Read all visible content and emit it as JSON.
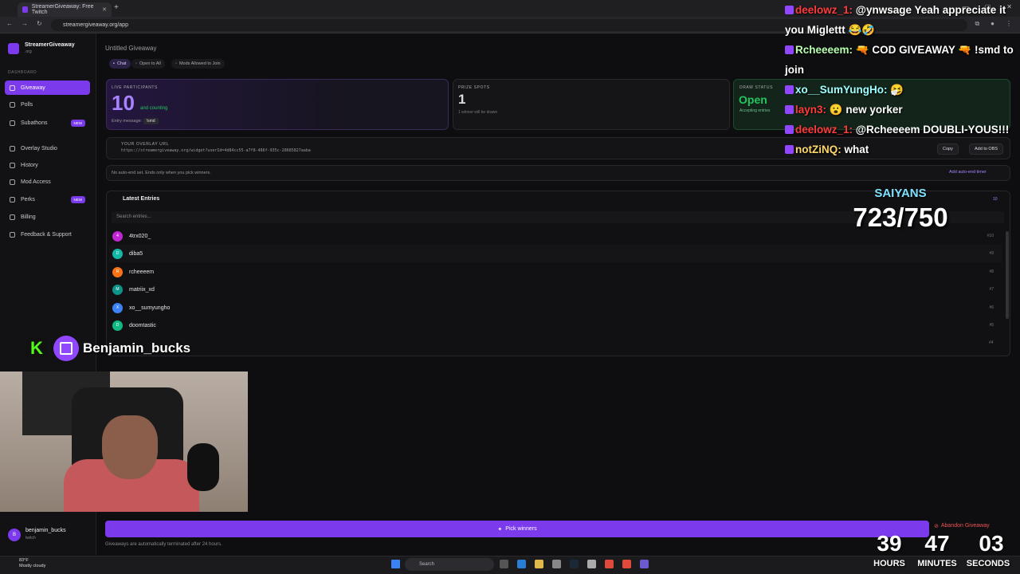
{
  "browser": {
    "tab_title": "StreamerGiveaway: Free Twitch",
    "url": "streamergiveaway.org/app"
  },
  "sidebar": {
    "brand": "StreamerGiveaway",
    "brand_sub": ".org",
    "section": "DASHBOARD",
    "items": [
      {
        "label": "Giveaway",
        "active": true
      },
      {
        "label": "Polls"
      },
      {
        "label": "Subathons",
        "badge": "NEW"
      },
      {
        "label": "Overlay Studio"
      },
      {
        "label": "History"
      },
      {
        "label": "Mod Access"
      },
      {
        "label": "Perks",
        "badge": "NEW"
      },
      {
        "label": "Billing"
      },
      {
        "label": "Feedback & Support"
      }
    ],
    "user": {
      "name": "benjamin_bucks",
      "platform": "twitch",
      "initial": "B"
    }
  },
  "main": {
    "title": "Untitled Giveaway",
    "chips": [
      "Chat",
      "Open to All",
      "Mods Allowed to Join"
    ],
    "participants": {
      "label": "LIVE PARTICIPANTS",
      "count": "10",
      "counting": "and counting",
      "entry_label": "Entry message:",
      "entry_cmd": "!smd"
    },
    "prize": {
      "label": "PRIZE SPOTS",
      "count": "1",
      "sub": "1 winner will be drawn"
    },
    "draw": {
      "label": "DRAW STATUS",
      "status": "Open",
      "sub": "Accepting entries"
    },
    "overlay": {
      "label": "YOUR OVERLAY URL",
      "url": "https://streamergiveaway.org/widget?userId=4d84cc55-a7f8-486f-935c-28685827aaba",
      "copy": "Copy",
      "obs": "Add to OBS"
    },
    "autoend": {
      "text": "No auto-end set. Ends only when you pick winners.",
      "btn": "Add auto-end timer"
    },
    "entries": {
      "title": "Latest Entries",
      "count": "10",
      "search_placeholder": "Search entries...",
      "rows": [
        {
          "name": "4trx020_",
          "initial": "4",
          "color": "#c026d3",
          "rank": "#10"
        },
        {
          "name": "diba5",
          "initial": "D",
          "color": "#14b8a6",
          "rank": "#9"
        },
        {
          "name": "rcheeeem",
          "initial": "R",
          "color": "#f97316",
          "rank": "#8"
        },
        {
          "name": "matriix_xd",
          "initial": "M",
          "color": "#0d9488",
          "rank": "#7"
        },
        {
          "name": "xo__sumyungho",
          "initial": "X",
          "color": "#3b82f6",
          "rank": "#6"
        },
        {
          "name": "doomtastic",
          "initial": "D",
          "color": "#10b981",
          "rank": "#5"
        }
      ],
      "last_rank": "#4"
    },
    "pick_button": "Pick winners",
    "abandon": "Abandon Giveaway",
    "auto_terminate": "Giveaways are automatically terminated after 24 hours."
  },
  "chat": [
    {
      "user": "deelowz_1:",
      "msg": "@ynwsage Yeah appreciate it you Miglettt 😂🤣",
      "color": "#ff3b3b"
    },
    {
      "user": "Rcheeeem:",
      "msg": "🔫 COD GIVEAWAY 🔫 !smd to join",
      "color": "#b8ffb0"
    },
    {
      "user": "xo__SumYungHo:",
      "msg": "🤧",
      "color": "#9fffff"
    },
    {
      "user": "layn3:",
      "msg": "😮 new yorker",
      "color": "#ff3b3b"
    },
    {
      "user": "deelowz_1:",
      "msg": "@Rcheeeem DOUBLI-YOUS!!!",
      "color": "#ff3b3b"
    },
    {
      "user": "notZiNQ:",
      "msg": "what",
      "color": "#ffd86b"
    }
  ],
  "goal": {
    "name": "SAIYANS",
    "progress": "723/750"
  },
  "stream": {
    "handle": "Benjamin_bucks",
    "kick_letter": "K"
  },
  "timer": {
    "hours": "39",
    "minutes": "47",
    "seconds": "03",
    "hours_lbl": "HOURS",
    "minutes_lbl": "MINUTES",
    "seconds_lbl": "SECONDS"
  },
  "taskbar": {
    "temp": "83°F",
    "weather": "Mostly cloudy",
    "search": "Search"
  }
}
